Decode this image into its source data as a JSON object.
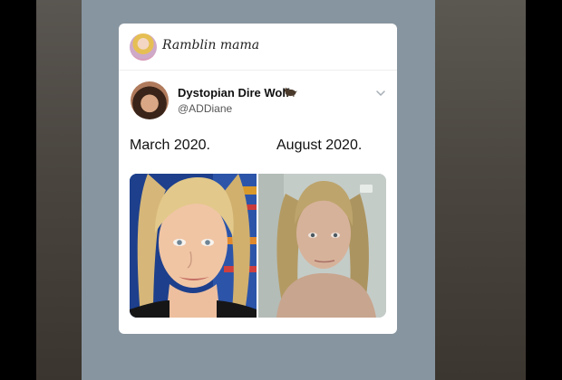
{
  "post": {
    "page_owner": "Ramblin mama"
  },
  "tweet": {
    "display_name": "Dystopian Dire Wolf",
    "handle": "@ADDiane",
    "emoji_icon": "wolf-emoji-icon",
    "captions": {
      "left": "March 2020.",
      "right": "August 2020."
    }
  },
  "colors": {
    "panel_background": "#8795a0",
    "card_background": "#ffffff"
  }
}
